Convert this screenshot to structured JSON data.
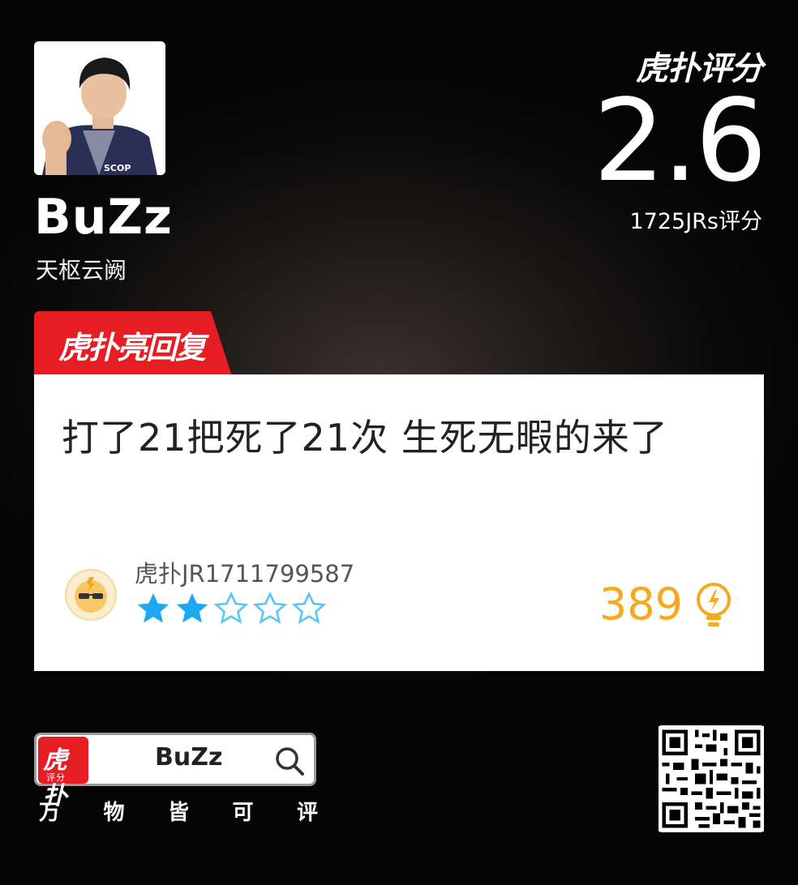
{
  "player": {
    "name": "BuZz",
    "team": "天枢云阙"
  },
  "rating": {
    "logo": "虎扑评分",
    "score": "2.6",
    "count": "1725JRs评分"
  },
  "hot_reply": {
    "tag": "虎扑亮回复",
    "accent_color": "#e61e24"
  },
  "comment": {
    "text": "打了21把死了21次 生死无暇的来了",
    "username": "虎扑JR1711799587",
    "stars_filled": 2,
    "stars_total": 5,
    "likes": "389",
    "like_color": "#f7a81d"
  },
  "footer": {
    "app_logo": "虎扑",
    "app_logo_sub": "评分",
    "search_text": "BuZz",
    "slogan": [
      "万",
      "物",
      "皆",
      "可",
      "评"
    ]
  },
  "icons": [
    "search-icon",
    "lightbulb-icon",
    "star-icon",
    "qr-code",
    "avatar-photo"
  ]
}
